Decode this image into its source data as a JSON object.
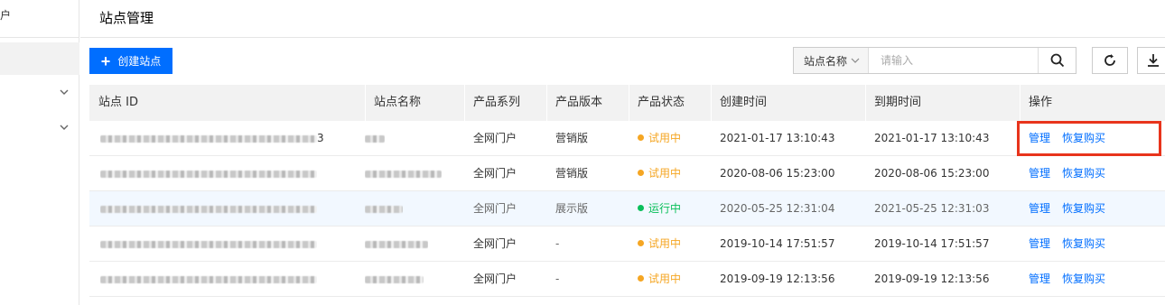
{
  "sidebar": {
    "top_fragment": "户",
    "colors": {
      "active_bg": "#f2f2f2"
    }
  },
  "page": {
    "title": "站点管理"
  },
  "toolbar": {
    "create_label": "创建站点",
    "search": {
      "filter_label": "站点名称",
      "placeholder": "请输入"
    }
  },
  "table": {
    "headers": [
      "站点 ID",
      "站点名称",
      "产品系列",
      "产品版本",
      "产品状态",
      "创建时间",
      "到期时间",
      "操作"
    ],
    "rows": [
      {
        "id_tail": "3",
        "series": "全网门户",
        "version": "营销版",
        "status": "试用中",
        "status_color": "#f5a623",
        "created": "2021-01-17 13:10:43",
        "expires": "2021-01-17 13:10:43",
        "action_manage": "管理",
        "action_renew": "恢复购买"
      },
      {
        "id_tail": "",
        "series": "全网门户",
        "version": "营销版",
        "status": "试用中",
        "status_color": "#f5a623",
        "created": "2020-08-06 15:23:00",
        "expires": "2020-08-06 15:23:00",
        "action_manage": "管理",
        "action_renew": "恢复购买"
      },
      {
        "id_tail": "",
        "series": "全网门户",
        "version": "展示版",
        "status": "运行中",
        "status_color": "#0abf5b",
        "created": "2020-05-25 12:31:04",
        "expires": "2021-05-25 12:31:03",
        "action_manage": "管理",
        "action_renew": "恢复购买"
      },
      {
        "id_tail": "",
        "series": "全网门户",
        "version": "-",
        "status": "试用中",
        "status_color": "#f5a623",
        "created": "2019-10-14 17:51:57",
        "expires": "2019-10-14 17:51:57",
        "action_manage": "管理",
        "action_renew": "恢复购买"
      },
      {
        "id_tail": "",
        "series": "全网门户",
        "version": "-",
        "status": "试用中",
        "status_color": "#f5a623",
        "created": "2019-09-19 12:13:56",
        "expires": "2019-09-19 12:13:56",
        "action_manage": "管理",
        "action_renew": "恢复购买"
      }
    ]
  },
  "colors": {
    "primary": "#006eff",
    "highlight_border": "#e8341c",
    "header_bg": "#f2f2f2"
  }
}
